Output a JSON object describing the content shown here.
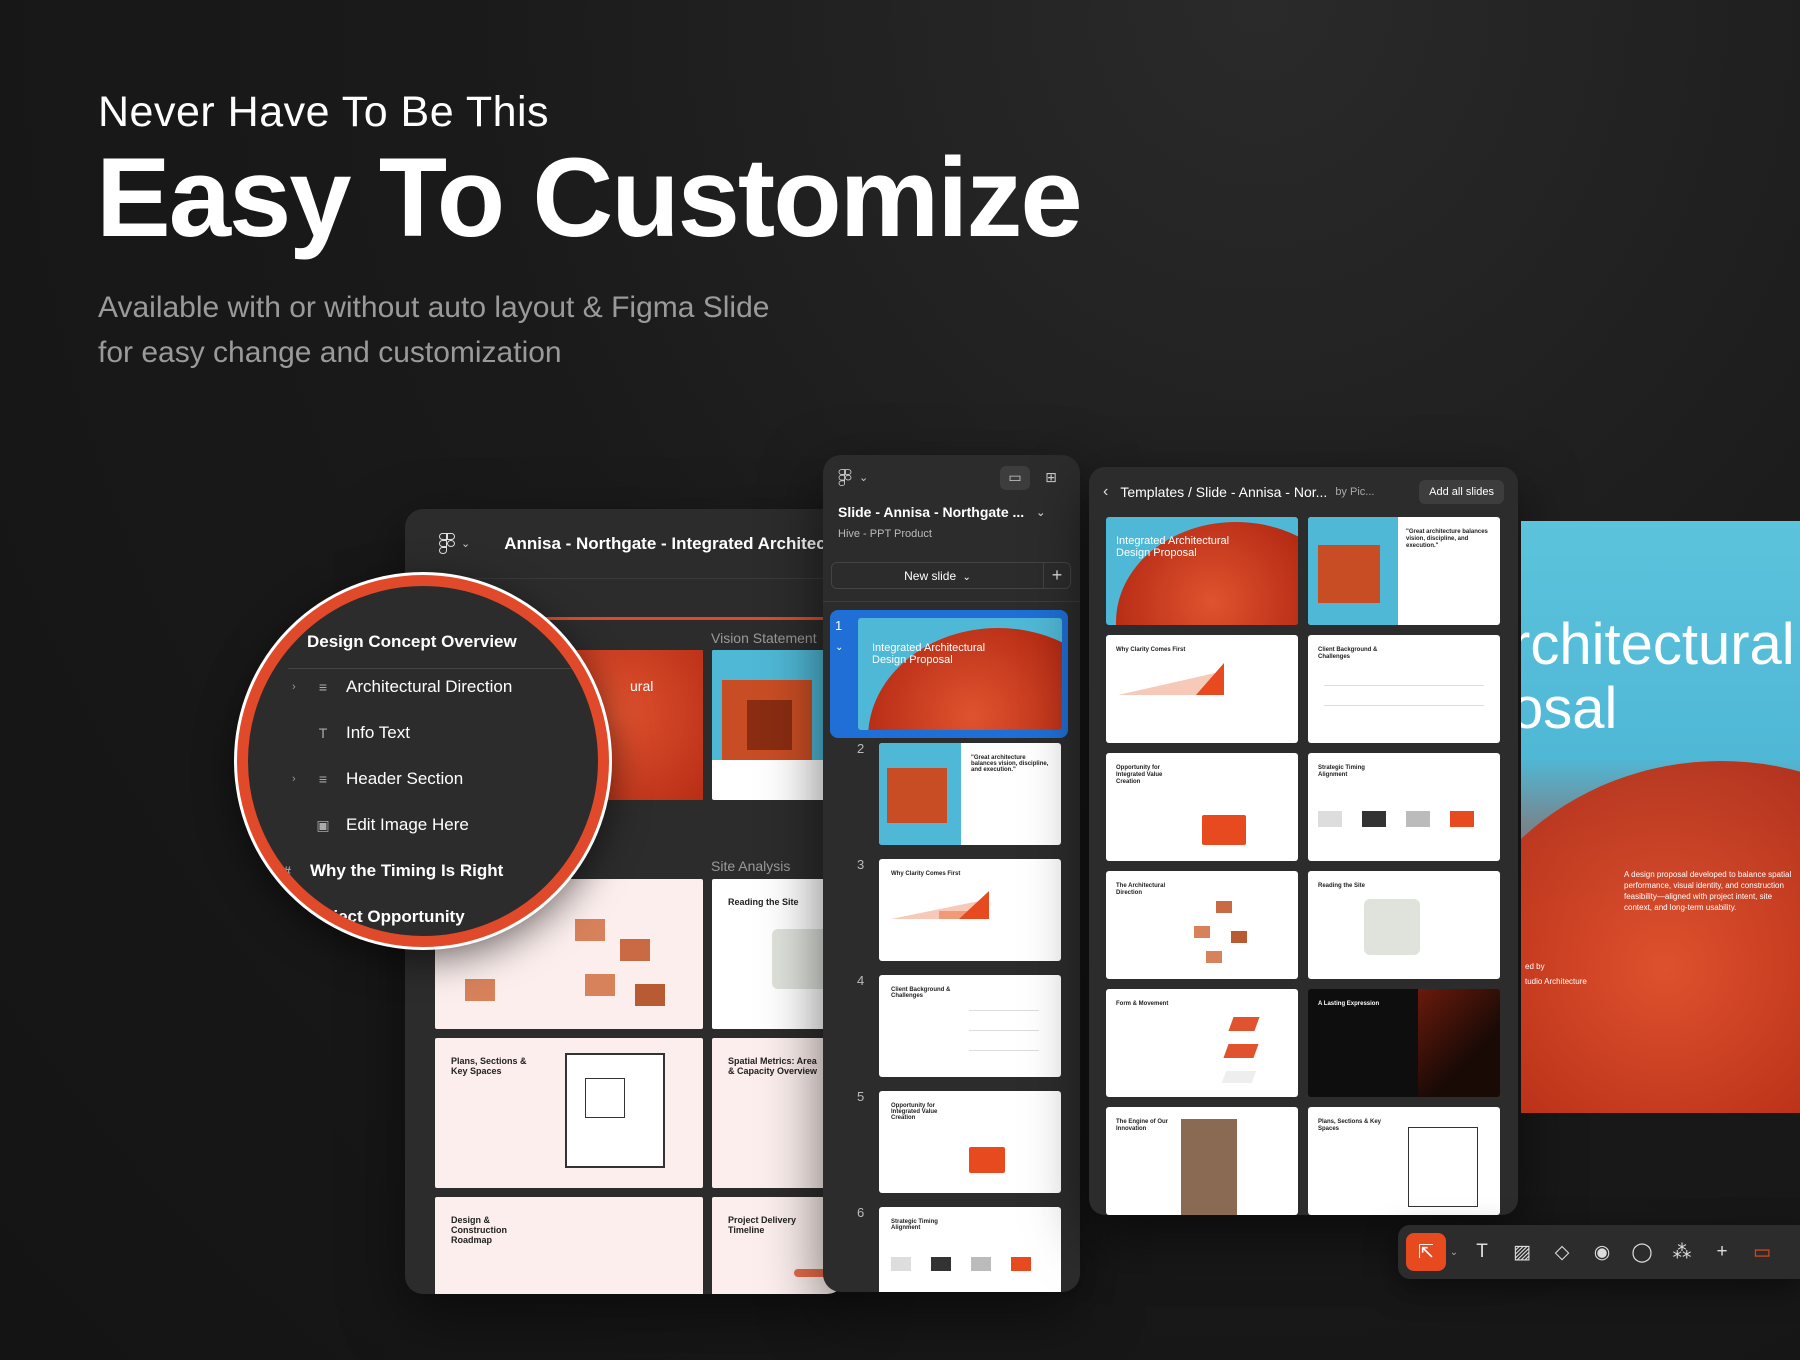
{
  "hero": {
    "eyebrow": "Never Have To Be This",
    "title": "Easy To Customize",
    "subtitle_line1": "Available with or without auto layout  & Figma Slide",
    "subtitle_line2": "for easy change and customization"
  },
  "editor": {
    "doc_title": "Annisa - Northgate - Integrated Architec",
    "slide_labels": [
      "Vision Statement",
      "Site Analysis"
    ],
    "thumbs": [
      {
        "caption": "Plans, Sections & Key Spaces"
      },
      {
        "caption": "Spatial Metrics: Area & Capacity Overview"
      },
      {
        "caption": "Design & Construction Roadmap"
      },
      {
        "caption": "Project Delivery Timeline"
      },
      {
        "caption": "Reading the Site"
      },
      {
        "caption": "ural"
      }
    ]
  },
  "layers": {
    "items": [
      {
        "label": "Design Concept Overview"
      },
      {
        "label": "Architectural Direction"
      },
      {
        "label": "Info Text"
      },
      {
        "label": "Header Section"
      },
      {
        "label": "Edit Image Here"
      },
      {
        "label": "Why the Timing Is Right"
      },
      {
        "label": "oject Opportunity"
      }
    ]
  },
  "slides_panel": {
    "title": "Slide - Annisa - Northgate ...",
    "subtitle": "Hive - PPT Product",
    "new_slide": "New slide",
    "slides": [
      {
        "num": "1",
        "caption": "Integrated Architectural Design Proposal"
      },
      {
        "num": "2",
        "caption": "\"Great architecture balances vision, discipline, and execution.\""
      },
      {
        "num": "3",
        "caption": "Why Clarity Comes First"
      },
      {
        "num": "4",
        "caption": "Client Background & Challenges"
      },
      {
        "num": "5",
        "caption": "Opportunity for Integrated Value Creation"
      },
      {
        "num": "6",
        "caption": "Strategic Timing Alignment"
      }
    ]
  },
  "templates_panel": {
    "breadcrumb": "Templates / Slide - Annisa - Nor...",
    "by": "by Pic...",
    "add_all": "Add all slides",
    "cards": [
      {
        "caption": "Integrated Architectural Design Proposal"
      },
      {
        "caption": "\"Great architecture balances vision, discipline, and execution.\""
      },
      {
        "caption": "Why Clarity Comes First"
      },
      {
        "caption": "Client Background & Challenges"
      },
      {
        "caption": "Opportunity for Integrated Value Creation"
      },
      {
        "caption": "Strategic Timing Alignment"
      },
      {
        "caption": "The Architectural Direction"
      },
      {
        "caption": "Reading the Site"
      },
      {
        "caption": "Form & Movement"
      },
      {
        "caption": "A Lasting Expression"
      },
      {
        "caption": "The Engine of Our Innovation"
      },
      {
        "caption": "Plans, Sections & Key Spaces"
      }
    ]
  },
  "preview": {
    "heading_line1": "rchitectural",
    "heading_line2": "osal",
    "description": "A design proposal developed to balance spatial performance, visual identity, and construction feasibility—aligned with project intent, site context, and long-term usability.",
    "by_line1": "ed by",
    "by_line2": "tudio Architecture"
  },
  "colors": {
    "accent": "#e04a2a",
    "selection": "#1f6fd6",
    "panel": "#2c2c2c",
    "sky": "#5cc3dc"
  }
}
